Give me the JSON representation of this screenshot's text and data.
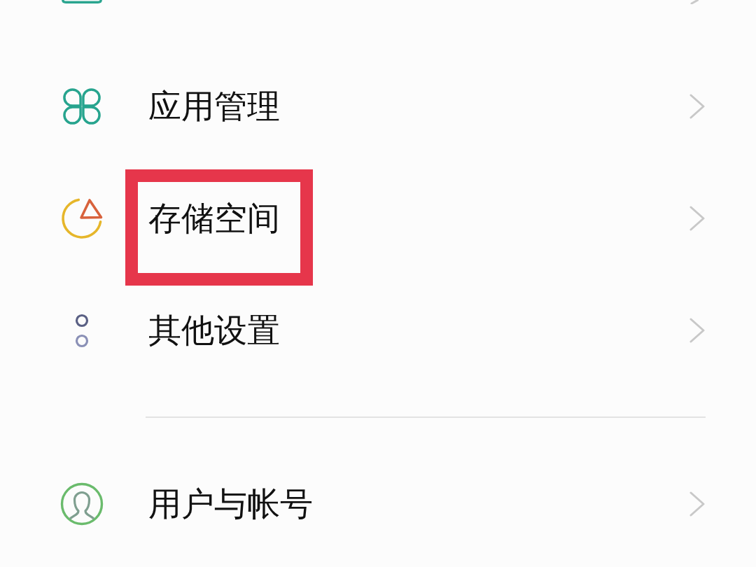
{
  "settings": {
    "groups": [
      {
        "items": [
          {
            "kind": "apps",
            "label": "应用管理",
            "highlighted": false
          },
          {
            "kind": "storage",
            "label": "存储空间",
            "highlighted": true
          },
          {
            "kind": "other",
            "label": "其他设置",
            "highlighted": false
          }
        ]
      },
      {
        "items": [
          {
            "kind": "accounts",
            "label": "用户与帐号",
            "highlighted": false
          }
        ]
      }
    ]
  }
}
